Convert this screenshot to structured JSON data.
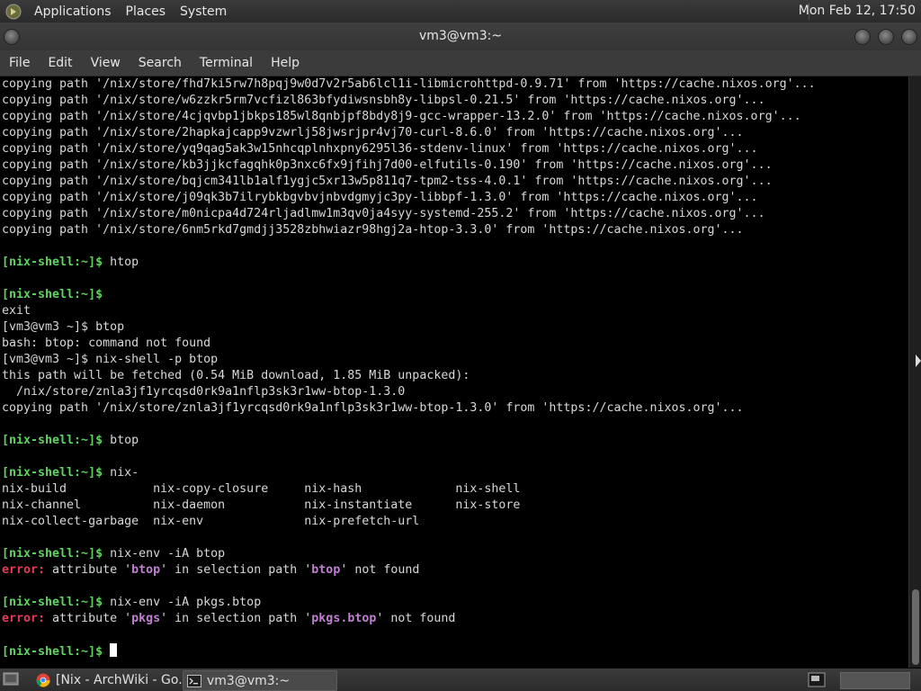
{
  "top_panel": {
    "menus": [
      "Applications",
      "Places",
      "System"
    ],
    "clock": "Mon Feb 12, 17:50"
  },
  "window": {
    "title": "vm3@vm3:~"
  },
  "menu_bar": [
    "File",
    "Edit",
    "View",
    "Search",
    "Terminal",
    "Help"
  ],
  "terminal": {
    "lines": [
      [
        {
          "t": "copying path '/nix/store/fhd7ki5rw7h8pqj9w0d7v2r5ab6lcl1i-libmicrohttpd-0.9.71' from 'https://cache.nixos.org'..."
        }
      ],
      [
        {
          "t": "copying path '/nix/store/w6zzkr5rm7vcfizl863bfydiwsnsbh8y-libpsl-0.21.5' from 'https://cache.nixos.org'..."
        }
      ],
      [
        {
          "t": "copying path '/nix/store/4cjqvbp1jbkps185wl8qnbjpf8bdy8j9-gcc-wrapper-13.2.0' from 'https://cache.nixos.org'..."
        }
      ],
      [
        {
          "t": "copying path '/nix/store/2hapkajcapp9vzwrlj58jwsrjpr4vj70-curl-8.6.0' from 'https://cache.nixos.org'..."
        }
      ],
      [
        {
          "t": "copying path '/nix/store/yq9qag5ak3w15nhcqplnhxpny6295l36-stdenv-linux' from 'https://cache.nixos.org'..."
        }
      ],
      [
        {
          "t": "copying path '/nix/store/kb3jjkcfagqhk0p3nxc6fx9jfihj7d00-elfutils-0.190' from 'https://cache.nixos.org'..."
        }
      ],
      [
        {
          "t": "copying path '/nix/store/bqjcm341lb1alf1ygjc5xr13w5p811q7-tpm2-tss-4.0.1' from 'https://cache.nixos.org'..."
        }
      ],
      [
        {
          "t": "copying path '/nix/store/j09qk3b7ilrybkbgvbvjnbvdgmyjc3py-libbpf-1.3.0' from 'https://cache.nixos.org'..."
        }
      ],
      [
        {
          "t": "copying path '/nix/store/m0nicpa4d724rljadlmw1m3qv0ja4syy-systemd-255.2' from 'https://cache.nixos.org'..."
        }
      ],
      [
        {
          "t": "copying path '/nix/store/6nm5rkd7gmdjj3528zbhwiazr98hgj2a-htop-3.3.0' from 'https://cache.nixos.org'..."
        }
      ],
      [],
      [
        {
          "t": "[nix-shell:~]$",
          "c": "prompt"
        },
        {
          "t": " htop"
        }
      ],
      [],
      [
        {
          "t": "[nix-shell:~]$",
          "c": "prompt"
        }
      ],
      [
        {
          "t": "exit"
        }
      ],
      [
        {
          "t": "[vm3@vm3 ~]$ btop"
        }
      ],
      [
        {
          "t": "bash: btop: command not found"
        }
      ],
      [
        {
          "t": "[vm3@vm3 ~]$ nix-shell -p btop"
        }
      ],
      [
        {
          "t": "this path will be fetched (0.54 MiB download, 1.85 MiB unpacked):"
        }
      ],
      [
        {
          "t": "  /nix/store/znla3jf1yrcqsd0rk9a1nflp3sk3r1ww-btop-1.3.0"
        }
      ],
      [
        {
          "t": "copying path '/nix/store/znla3jf1yrcqsd0rk9a1nflp3sk3r1ww-btop-1.3.0' from 'https://cache.nixos.org'..."
        }
      ],
      [],
      [
        {
          "t": "[nix-shell:~]$",
          "c": "prompt"
        },
        {
          "t": " btop"
        }
      ],
      [],
      [
        {
          "t": "[nix-shell:~]$",
          "c": "prompt"
        },
        {
          "t": " nix-"
        }
      ],
      [
        {
          "t": "nix-build            nix-copy-closure     nix-hash             nix-shell"
        }
      ],
      [
        {
          "t": "nix-channel          nix-daemon           nix-instantiate      nix-store"
        }
      ],
      [
        {
          "t": "nix-collect-garbage  nix-env              nix-prefetch-url"
        }
      ],
      [],
      [
        {
          "t": "[nix-shell:~]$",
          "c": "prompt"
        },
        {
          "t": " nix-env -iA btop"
        }
      ],
      [
        {
          "t": "error:",
          "c": "err"
        },
        {
          "t": " attribute "
        },
        {
          "t": "'"
        },
        {
          "t": "btop",
          "c": "hl"
        },
        {
          "t": "'"
        },
        {
          "t": " in selection path "
        },
        {
          "t": "'"
        },
        {
          "t": "btop",
          "c": "hl"
        },
        {
          "t": "'"
        },
        {
          "t": " not found"
        }
      ],
      [],
      [
        {
          "t": "[nix-shell:~]$",
          "c": "prompt"
        },
        {
          "t": " nix-env -iA pkgs.btop"
        }
      ],
      [
        {
          "t": "error:",
          "c": "err"
        },
        {
          "t": " attribute "
        },
        {
          "t": "'"
        },
        {
          "t": "pkgs",
          "c": "hl"
        },
        {
          "t": "'"
        },
        {
          "t": " in selection path "
        },
        {
          "t": "'"
        },
        {
          "t": "pkgs.btop",
          "c": "hl"
        },
        {
          "t": "'"
        },
        {
          "t": " not found"
        }
      ],
      [],
      [
        {
          "t": "[nix-shell:~]$",
          "c": "prompt"
        },
        {
          "t": " "
        },
        {
          "cursor": true
        }
      ]
    ]
  },
  "taskbar": {
    "tasks": [
      {
        "label": "[Nix - ArchWiki - Go...",
        "icon": "chrome-icon",
        "active": false
      },
      {
        "label": "vm3@vm3:~",
        "icon": "terminal-icon",
        "active": true
      }
    ]
  },
  "colors": {
    "prompt": "#5fd35f",
    "error": "#e03b5a",
    "highlight": "#c080d0"
  }
}
